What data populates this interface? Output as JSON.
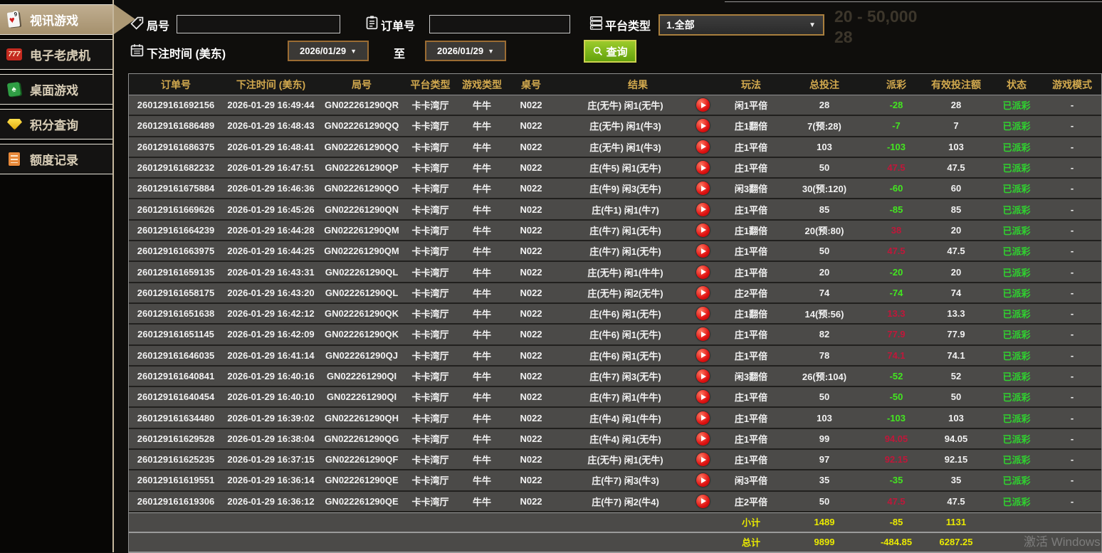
{
  "sidebar": {
    "items": [
      {
        "label": "视讯游戏",
        "icon": "video-games-icon",
        "active": true
      },
      {
        "label": "电子老虎机",
        "icon": "slot-machine-icon",
        "active": false
      },
      {
        "label": "桌面游戏",
        "icon": "table-games-icon",
        "active": false
      },
      {
        "label": "积分查询",
        "icon": "points-query-icon",
        "active": false
      },
      {
        "label": "额度记录",
        "icon": "quota-records-icon",
        "active": false
      }
    ]
  },
  "filters": {
    "round_label": "局号",
    "round_value": "",
    "order_label": "订单号",
    "order_value": "",
    "platform_label": "平台类型",
    "platform_value": "1.全部",
    "bet_time_label": "下注时间 (美东)",
    "date_from": "2026/01/29",
    "to_label": "至",
    "date_to": "2026/01/29",
    "search_label": "查询"
  },
  "table": {
    "columns": [
      "订单号",
      "下注时间 (美东)",
      "局号",
      "平台类型",
      "游戏类型",
      "桌号",
      "结果",
      "玩法",
      "总投注",
      "派彩",
      "有效投注额",
      "状态",
      "游戏模式"
    ],
    "rows": [
      [
        "260129161692156",
        "2026-01-29 16:49:44",
        "GN022261290QR",
        "卡卡湾厅",
        "牛牛",
        "N022",
        "庄(无牛) 闲1(无牛)",
        "闲1平倍",
        "28",
        "-28",
        "28",
        "已派彩",
        "-"
      ],
      [
        "260129161686489",
        "2026-01-29 16:48:43",
        "GN022261290QQ",
        "卡卡湾厅",
        "牛牛",
        "N022",
        "庄(无牛) 闲1(牛3)",
        "庄1翻倍",
        "7(预:28)",
        "-7",
        "7",
        "已派彩",
        "-"
      ],
      [
        "260129161686375",
        "2026-01-29 16:48:41",
        "GN022261290QQ",
        "卡卡湾厅",
        "牛牛",
        "N022",
        "庄(无牛) 闲1(牛3)",
        "庄1平倍",
        "103",
        "-103",
        "103",
        "已派彩",
        "-"
      ],
      [
        "260129161682232",
        "2026-01-29 16:47:51",
        "GN022261290QP",
        "卡卡湾厅",
        "牛牛",
        "N022",
        "庄(牛5) 闲1(无牛)",
        "庄1平倍",
        "50",
        "47.5",
        "47.5",
        "已派彩",
        "-"
      ],
      [
        "260129161675884",
        "2026-01-29 16:46:36",
        "GN022261290QO",
        "卡卡湾厅",
        "牛牛",
        "N022",
        "庄(牛9) 闲3(无牛)",
        "闲3翻倍",
        "30(预:120)",
        "-60",
        "60",
        "已派彩",
        "-"
      ],
      [
        "260129161669626",
        "2026-01-29 16:45:26",
        "GN022261290QN",
        "卡卡湾厅",
        "牛牛",
        "N022",
        "庄(牛1) 闲1(牛7)",
        "庄1平倍",
        "85",
        "-85",
        "85",
        "已派彩",
        "-"
      ],
      [
        "260129161664239",
        "2026-01-29 16:44:28",
        "GN022261290QM",
        "卡卡湾厅",
        "牛牛",
        "N022",
        "庄(牛7) 闲1(无牛)",
        "庄1翻倍",
        "20(预:80)",
        "38",
        "20",
        "已派彩",
        "-"
      ],
      [
        "260129161663975",
        "2026-01-29 16:44:25",
        "GN022261290QM",
        "卡卡湾厅",
        "牛牛",
        "N022",
        "庄(牛7) 闲1(无牛)",
        "庄1平倍",
        "50",
        "47.5",
        "47.5",
        "已派彩",
        "-"
      ],
      [
        "260129161659135",
        "2026-01-29 16:43:31",
        "GN022261290QL",
        "卡卡湾厅",
        "牛牛",
        "N022",
        "庄(无牛) 闲1(牛牛)",
        "庄1平倍",
        "20",
        "-20",
        "20",
        "已派彩",
        "-"
      ],
      [
        "260129161658175",
        "2026-01-29 16:43:20",
        "GN022261290QL",
        "卡卡湾厅",
        "牛牛",
        "N022",
        "庄(无牛) 闲2(无牛)",
        "庄2平倍",
        "74",
        "-74",
        "74",
        "已派彩",
        "-"
      ],
      [
        "260129161651638",
        "2026-01-29 16:42:12",
        "GN022261290QK",
        "卡卡湾厅",
        "牛牛",
        "N022",
        "庄(牛6) 闲1(无牛)",
        "庄1翻倍",
        "14(预:56)",
        "13.3",
        "13.3",
        "已派彩",
        "-"
      ],
      [
        "260129161651145",
        "2026-01-29 16:42:09",
        "GN022261290QK",
        "卡卡湾厅",
        "牛牛",
        "N022",
        "庄(牛6) 闲1(无牛)",
        "庄1平倍",
        "82",
        "77.9",
        "77.9",
        "已派彩",
        "-"
      ],
      [
        "260129161646035",
        "2026-01-29 16:41:14",
        "GN022261290QJ",
        "卡卡湾厅",
        "牛牛",
        "N022",
        "庄(牛6) 闲1(无牛)",
        "庄1平倍",
        "78",
        "74.1",
        "74.1",
        "已派彩",
        "-"
      ],
      [
        "260129161640841",
        "2026-01-29 16:40:16",
        "GN022261290QI",
        "卡卡湾厅",
        "牛牛",
        "N022",
        "庄(牛7) 闲3(无牛)",
        "闲3翻倍",
        "26(预:104)",
        "-52",
        "52",
        "已派彩",
        "-"
      ],
      [
        "260129161640454",
        "2026-01-29 16:40:10",
        "GN022261290QI",
        "卡卡湾厅",
        "牛牛",
        "N022",
        "庄(牛7) 闲1(牛牛)",
        "庄1平倍",
        "50",
        "-50",
        "50",
        "已派彩",
        "-"
      ],
      [
        "260129161634480",
        "2026-01-29 16:39:02",
        "GN022261290QH",
        "卡卡湾厅",
        "牛牛",
        "N022",
        "庄(牛4) 闲1(牛牛)",
        "庄1平倍",
        "103",
        "-103",
        "103",
        "已派彩",
        "-"
      ],
      [
        "260129161629528",
        "2026-01-29 16:38:04",
        "GN022261290QG",
        "卡卡湾厅",
        "牛牛",
        "N022",
        "庄(牛4) 闲1(无牛)",
        "庄1平倍",
        "99",
        "94.05",
        "94.05",
        "已派彩",
        "-"
      ],
      [
        "260129161625235",
        "2026-01-29 16:37:15",
        "GN022261290QF",
        "卡卡湾厅",
        "牛牛",
        "N022",
        "庄(无牛) 闲1(无牛)",
        "庄1平倍",
        "97",
        "92.15",
        "92.15",
        "已派彩",
        "-"
      ],
      [
        "260129161619551",
        "2026-01-29 16:36:14",
        "GN022261290QE",
        "卡卡湾厅",
        "牛牛",
        "N022",
        "庄(牛7) 闲3(牛3)",
        "闲3平倍",
        "35",
        "-35",
        "35",
        "已派彩",
        "-"
      ],
      [
        "260129161619306",
        "2026-01-29 16:36:12",
        "GN022261290QE",
        "卡卡湾厅",
        "牛牛",
        "N022",
        "庄(牛7) 闲2(牛4)",
        "庄2平倍",
        "50",
        "47.5",
        "47.5",
        "已派彩",
        "-"
      ]
    ],
    "subtotal": {
      "label": "小计",
      "total_bet": "1489",
      "payout": "-85",
      "valid_bet": "1131"
    },
    "grand_total": {
      "label": "总计",
      "total_bet": "9899",
      "payout": "-484.85",
      "valid_bet": "6287.25"
    }
  },
  "ghost": {
    "limit_text": "20 - 50,000",
    "count_text": "28",
    "watermark": "激活 Windows"
  },
  "colors": {
    "accent_gold": "#d2a94e",
    "active_tab": "#b2a083",
    "win_red": "#c0173a",
    "lose_green": "#43e620",
    "status_green": "#2fd32f",
    "total_yellow": "#eaea00",
    "search_green": "#7cb71c",
    "date_border": "#9b6c33"
  }
}
